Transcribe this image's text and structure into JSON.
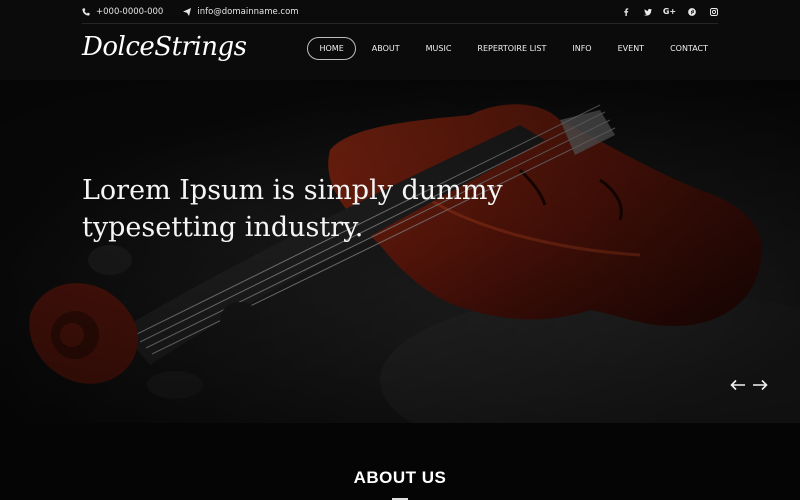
{
  "topbar": {
    "phone": "+000-0000-000",
    "email": "info@domainname.com",
    "social": [
      "facebook-icon",
      "twitter-icon",
      "google-plus-icon",
      "pinterest-icon",
      "instagram-icon"
    ],
    "google_plus_label": "G+"
  },
  "header": {
    "logo": "DolceStrings",
    "nav": [
      {
        "label": "HOME",
        "active": true
      },
      {
        "label": "ABOUT"
      },
      {
        "label": "MUSIC"
      },
      {
        "label": "REPERTOIRE LIST"
      },
      {
        "label": "INFO"
      },
      {
        "label": "EVENT"
      },
      {
        "label": "CONTACT"
      }
    ]
  },
  "hero": {
    "title": "Lorem Ipsum is simply dummy typesetting industry."
  },
  "about": {
    "title": "ABOUT US"
  },
  "colors": {
    "background": "#050505",
    "violin_wood": "#6b1a0c",
    "text": "#ffffff"
  }
}
